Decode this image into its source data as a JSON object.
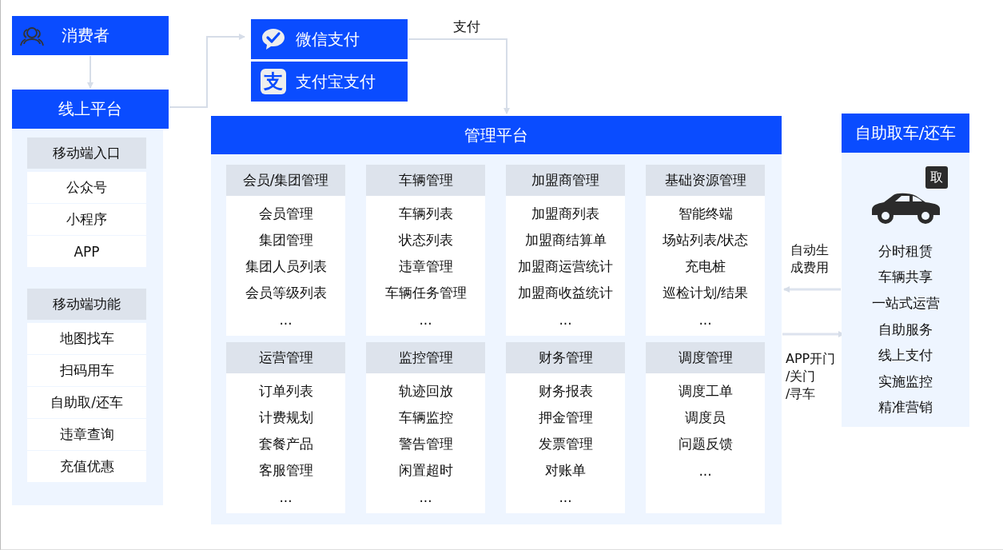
{
  "consumer": {
    "label": "消费者"
  },
  "online_platform": {
    "label": "线上平台"
  },
  "mobile_groups": [
    {
      "title": "移动端入口",
      "items": [
        "公众号",
        "小程序",
        "APP"
      ]
    },
    {
      "title": "移动端功能",
      "items": [
        "地图找车",
        "扫码用车",
        "自助取/还车",
        "违章查询",
        "充值优惠"
      ]
    }
  ],
  "payments": [
    {
      "kind": "wechat",
      "label": "微信支付"
    },
    {
      "kind": "alipay",
      "label": "支付宝支付",
      "icon_text": "支"
    }
  ],
  "payment_flow_label": "支付",
  "management": {
    "title": "管理平台",
    "modules": [
      {
        "title": "会员/集团管理",
        "items": [
          "会员管理",
          "集团管理",
          "集团人员列表",
          "会员等级列表",
          "..."
        ]
      },
      {
        "title": "车辆管理",
        "items": [
          "车辆列表",
          "状态列表",
          "违章管理",
          "车辆任务管理",
          "..."
        ]
      },
      {
        "title": "加盟商管理",
        "items": [
          "加盟商列表",
          "加盟商结算单",
          "加盟商运营统计",
          "加盟商收益统计",
          "..."
        ]
      },
      {
        "title": "基础资源管理",
        "items": [
          "智能终端",
          "场站列表/状态",
          "充电桩",
          "巡检计划/结果",
          "..."
        ]
      },
      {
        "title": "运营管理",
        "items": [
          "订单列表",
          "计费规划",
          "套餐产品",
          "客服管理",
          "..."
        ]
      },
      {
        "title": "监控管理",
        "items": [
          "轨迹回放",
          "车辆监控",
          "警告管理",
          "闲置超时",
          "..."
        ]
      },
      {
        "title": "财务管理",
        "items": [
          "财务报表",
          "押金管理",
          "发票管理",
          "对账单",
          "..."
        ]
      },
      {
        "title": "调度管理",
        "items": [
          "调度工单",
          "调度员",
          "问题反馈",
          "..."
        ]
      }
    ]
  },
  "edge_labels": [
    "自动生成费用",
    "APP开门\n/关门\n/寻车"
  ],
  "self_service": {
    "title": "自助取车/还车",
    "badge": "取",
    "items": [
      "分时租赁",
      "车辆共享",
      "一站式运营",
      "自助服务",
      "线上支付",
      "实施监控",
      "精准营销"
    ]
  }
}
